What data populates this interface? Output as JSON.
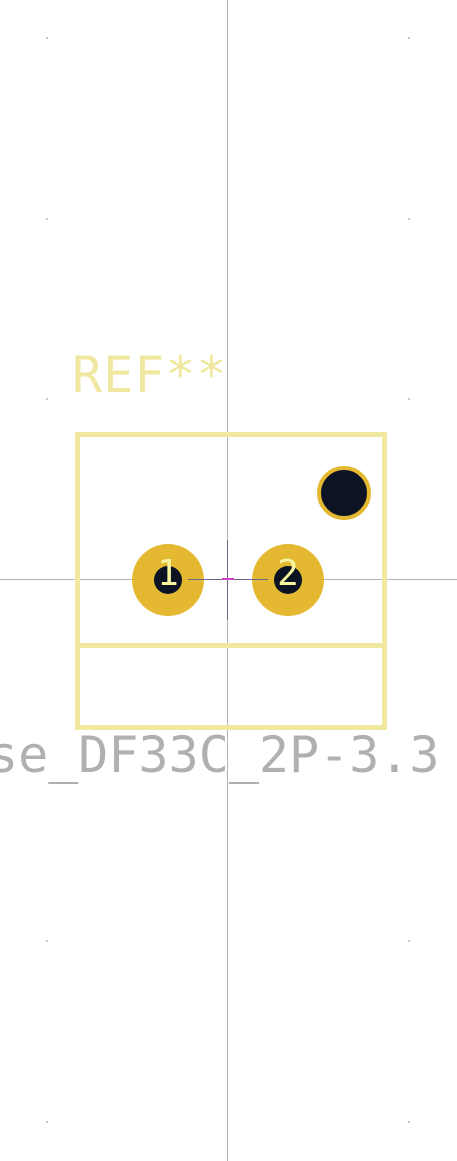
{
  "footprint": {
    "reference": "REF**",
    "value": "se_DF33C_2P-3.3",
    "pads": [
      {
        "number": "1"
      },
      {
        "number": "2"
      }
    ]
  },
  "colors": {
    "background": "#ffffff",
    "silkscreen": "#f0e8a0",
    "fab_text": "#b0b0b0",
    "pad_copper": "#e4b830",
    "drill_hole": "#0c1424",
    "crosshair": "#b4b4b4"
  }
}
